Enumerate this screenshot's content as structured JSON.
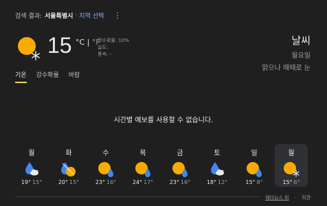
{
  "header": {
    "search_result_label": "검색 결과:",
    "location": "서울특별시",
    "separator": "·",
    "change_region": "지역 선택",
    "menu_glyph": "⋮"
  },
  "current": {
    "icon": "sunny-snow-icon",
    "temp": "15",
    "unit_c": "°C",
    "unit_sep": "|",
    "unit_f": "°F",
    "precip": "강수확률: 10%",
    "humidity": "습도: ",
    "wind": "풍속: -"
  },
  "summary": {
    "title": "날씨",
    "day": "월요일",
    "condition": "맑으나 때때로 눈"
  },
  "tabs": [
    {
      "label": "기온",
      "active": true
    },
    {
      "label": "강수확률",
      "active": false
    },
    {
      "label": "바람",
      "active": false
    }
  ],
  "message": "시간별 예보를 사용할 수 없습니다.",
  "forecast": [
    {
      "day": "월",
      "icon": "rain-cloud-icon",
      "hi": "19°",
      "lo": "15°"
    },
    {
      "day": "화",
      "icon": "rain-sun-icon",
      "hi": "20°",
      "lo": "15°"
    },
    {
      "day": "수",
      "icon": "sun-rain-icon",
      "hi": "23°",
      "lo": "16°"
    },
    {
      "day": "목",
      "icon": "sun-rain-icon",
      "hi": "24°",
      "lo": "17°"
    },
    {
      "day": "금",
      "icon": "sun-rain-icon",
      "hi": "23°",
      "lo": "16°"
    },
    {
      "day": "토",
      "icon": "rain-cloud-icon",
      "hi": "18°",
      "lo": "12°"
    },
    {
      "day": "일",
      "icon": "sun-rain-icon",
      "hi": "15°",
      "lo": "8°"
    },
    {
      "day": "월",
      "icon": "sun-snow-icon",
      "hi": "15°",
      "lo": "6°"
    }
  ],
  "footer": {
    "source": "웨더뉴스 위",
    "dot": "·",
    "feedback": "의견"
  },
  "colors": {
    "background": "#1f1f1f",
    "sun": "#f9ab00",
    "rain": "#4285f4",
    "tab_indicator": "#fdd663",
    "link": "#8ab4f8"
  }
}
